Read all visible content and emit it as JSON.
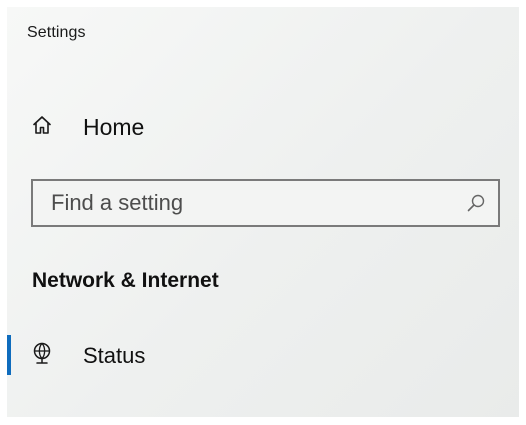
{
  "window": {
    "title": "Settings"
  },
  "nav": {
    "home": {
      "label": "Home",
      "icon": "home-icon"
    }
  },
  "search": {
    "placeholder": "Find a setting",
    "value": "",
    "icon": "search-icon"
  },
  "section": {
    "heading": "Network & Internet"
  },
  "items": [
    {
      "label": "Status",
      "icon": "network-status-icon",
      "selected": true
    }
  ],
  "colors": {
    "accent": "#0f6cbd",
    "background": "#eef0ef",
    "text": "#111111",
    "search_border": "#7a7a7a"
  }
}
